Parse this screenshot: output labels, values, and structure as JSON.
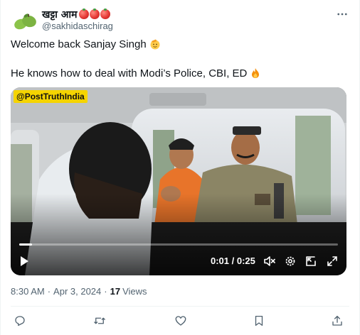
{
  "author": {
    "display_name": "खट्टा आम",
    "handle": "@sakhidaschirag",
    "name_emojis": [
      "tomato",
      "tomato",
      "tomato"
    ],
    "avatar_icon": "green-mango-avatar"
  },
  "post": {
    "line1": "Welcome back Sanjay Singh",
    "line1_emoji": "saluting-face",
    "line2": "He knows how to deal with Modi’s Police, CBI, ED",
    "line2_emoji": "fire"
  },
  "video": {
    "source_tag": "@PostTruthIndia",
    "time": "0:01 / 0:25",
    "progress": 0.04
  },
  "meta": {
    "time": "8:30 AM",
    "separator": "·",
    "date": "Apr 3, 2024",
    "views_count": "17",
    "views_label": "Views"
  },
  "colors": {
    "text": "#0f1419",
    "secondary": "#536471",
    "divider": "#eff3f4",
    "source_tag_bg": "#f5d400"
  }
}
